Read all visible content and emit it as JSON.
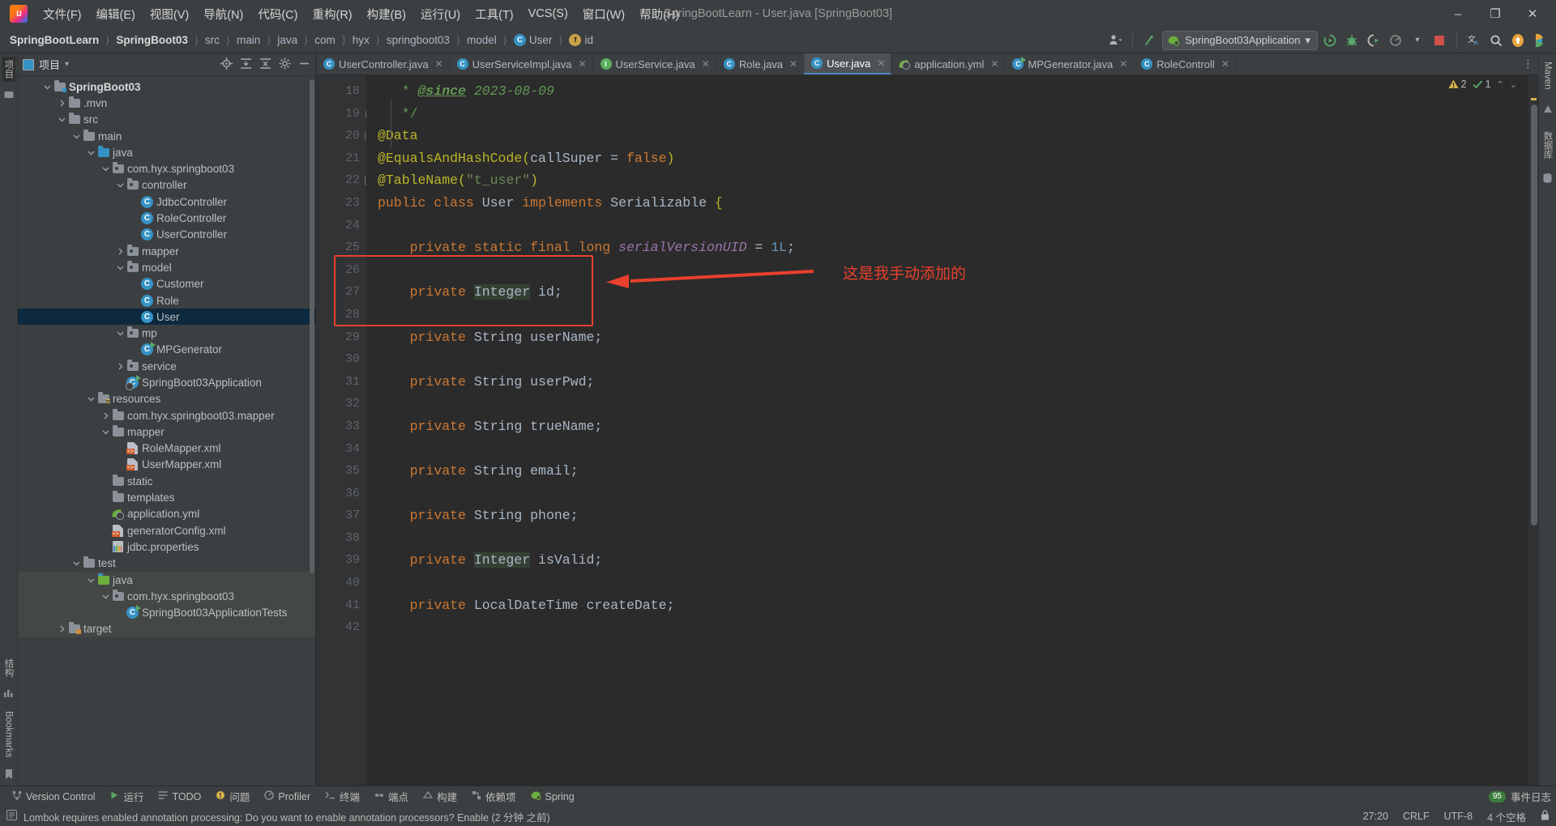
{
  "window": {
    "title": "SpringBootLearn - User.java [SpringBoot03]",
    "minimize": "–",
    "maximize": "❐",
    "close": "✕"
  },
  "menu": {
    "logo": "ij-logo",
    "items": [
      "文件(F)",
      "编辑(E)",
      "视图(V)",
      "导航(N)",
      "代码(C)",
      "重构(R)",
      "构建(B)",
      "运行(U)",
      "工具(T)",
      "VCS(S)",
      "窗口(W)",
      "帮助(H)"
    ]
  },
  "breadcrumb": {
    "items": [
      {
        "label": "SpringBootLearn",
        "icon": "",
        "bold": true
      },
      {
        "label": "SpringBoot03",
        "icon": "",
        "bold": true
      },
      {
        "label": "src",
        "icon": "",
        "bold": false
      },
      {
        "label": "main",
        "icon": "",
        "bold": false
      },
      {
        "label": "java",
        "icon": "",
        "bold": false
      },
      {
        "label": "com",
        "icon": "",
        "bold": false
      },
      {
        "label": "hyx",
        "icon": "",
        "bold": false
      },
      {
        "label": "springboot03",
        "icon": "",
        "bold": false
      },
      {
        "label": "model",
        "icon": "",
        "bold": false
      },
      {
        "label": "User",
        "icon": "class-badge",
        "bold": false
      },
      {
        "label": "id",
        "icon": "field-badge",
        "bold": false
      }
    ],
    "separator": "〉"
  },
  "toolbar": {
    "run_config": "SpringBoot03Application",
    "run_config_caret": "▾",
    "profile_icon": "user-profile-icon",
    "updates_icon": "updates-arrow-icon",
    "run_icon": "run-icon",
    "debug_icon": "debug-icon",
    "run_with_coverage_icon": "coverage-icon",
    "profiler_icon": "profiler-icon",
    "stop_icon": "stop-icon",
    "translate_icon": "translate-icon",
    "search_icon": "search-icon",
    "update_icon": "update-icon",
    "ide_icon": "ide-icon"
  },
  "project_panel": {
    "title": "项目",
    "caret": "▾",
    "header_icons": [
      "locate-icon",
      "expand-all-icon",
      "collapse-all-icon",
      "settings-icon",
      "hide-icon"
    ],
    "tree": [
      {
        "depth": 1,
        "arrow": "down",
        "icon": "folder-module",
        "label": "SpringBoot03",
        "bold": true,
        "sel": false,
        "shade": false
      },
      {
        "depth": 2,
        "arrow": "right",
        "icon": "folder",
        "label": ".mvn",
        "bold": false,
        "sel": false,
        "shade": false
      },
      {
        "depth": 2,
        "arrow": "down",
        "icon": "folder",
        "label": "src",
        "bold": false,
        "sel": false,
        "shade": false
      },
      {
        "depth": 3,
        "arrow": "down",
        "icon": "folder",
        "label": "main",
        "bold": false,
        "sel": false,
        "shade": false
      },
      {
        "depth": 4,
        "arrow": "down",
        "icon": "folder-source",
        "label": "java",
        "bold": false,
        "sel": false,
        "shade": false
      },
      {
        "depth": 5,
        "arrow": "down",
        "icon": "folder-package",
        "label": "com.hyx.springboot03",
        "bold": false,
        "sel": false,
        "shade": false
      },
      {
        "depth": 6,
        "arrow": "down",
        "icon": "folder-package",
        "label": "controller",
        "bold": false,
        "sel": false,
        "shade": false
      },
      {
        "depth": 7,
        "arrow": "none",
        "icon": "class",
        "label": "JdbcController",
        "bold": false,
        "sel": false,
        "shade": false
      },
      {
        "depth": 7,
        "arrow": "none",
        "icon": "class",
        "label": "RoleController",
        "bold": false,
        "sel": false,
        "shade": false
      },
      {
        "depth": 7,
        "arrow": "none",
        "icon": "class",
        "label": "UserController",
        "bold": false,
        "sel": false,
        "shade": false
      },
      {
        "depth": 6,
        "arrow": "right",
        "icon": "folder-package",
        "label": "mapper",
        "bold": false,
        "sel": false,
        "shade": false
      },
      {
        "depth": 6,
        "arrow": "down",
        "icon": "folder-package",
        "label": "model",
        "bold": false,
        "sel": false,
        "shade": false
      },
      {
        "depth": 7,
        "arrow": "none",
        "icon": "class",
        "label": "Customer",
        "bold": false,
        "sel": false,
        "shade": false
      },
      {
        "depth": 7,
        "arrow": "none",
        "icon": "class",
        "label": "Role",
        "bold": false,
        "sel": false,
        "shade": false
      },
      {
        "depth": 7,
        "arrow": "none",
        "icon": "class",
        "label": "User",
        "bold": false,
        "sel": true,
        "shade": false
      },
      {
        "depth": 6,
        "arrow": "down",
        "icon": "folder-package",
        "label": "mp",
        "bold": false,
        "sel": false,
        "shade": false
      },
      {
        "depth": 7,
        "arrow": "none",
        "icon": "class-runnable",
        "label": "MPGenerator",
        "bold": false,
        "sel": false,
        "shade": false
      },
      {
        "depth": 6,
        "arrow": "right",
        "icon": "folder-package",
        "label": "service",
        "bold": false,
        "sel": false,
        "shade": false
      },
      {
        "depth": 6,
        "arrow": "none",
        "icon": "class-spring",
        "label": "SpringBoot03Application",
        "bold": false,
        "sel": false,
        "shade": false
      },
      {
        "depth": 4,
        "arrow": "down",
        "icon": "folder-resource",
        "label": "resources",
        "bold": false,
        "sel": false,
        "shade": false
      },
      {
        "depth": 5,
        "arrow": "right",
        "icon": "folder",
        "label": "com.hyx.springboot03.mapper",
        "bold": false,
        "sel": false,
        "shade": false
      },
      {
        "depth": 5,
        "arrow": "down",
        "icon": "folder",
        "label": "mapper",
        "bold": false,
        "sel": false,
        "shade": false
      },
      {
        "depth": 6,
        "arrow": "none",
        "icon": "xml",
        "label": "RoleMapper.xml",
        "bold": false,
        "sel": false,
        "shade": false
      },
      {
        "depth": 6,
        "arrow": "none",
        "icon": "xml",
        "label": "UserMapper.xml",
        "bold": false,
        "sel": false,
        "shade": false
      },
      {
        "depth": 5,
        "arrow": "none",
        "icon": "folder",
        "label": "static",
        "bold": false,
        "sel": false,
        "shade": false
      },
      {
        "depth": 5,
        "arrow": "none",
        "icon": "folder",
        "label": "templates",
        "bold": false,
        "sel": false,
        "shade": false
      },
      {
        "depth": 5,
        "arrow": "none",
        "icon": "yml",
        "label": "application.yml",
        "bold": false,
        "sel": false,
        "shade": false
      },
      {
        "depth": 5,
        "arrow": "none",
        "icon": "xml",
        "label": "generatorConfig.xml",
        "bold": false,
        "sel": false,
        "shade": false
      },
      {
        "depth": 5,
        "arrow": "none",
        "icon": "properties",
        "label": "jdbc.properties",
        "bold": false,
        "sel": false,
        "shade": false
      },
      {
        "depth": 3,
        "arrow": "down",
        "icon": "folder",
        "label": "test",
        "bold": false,
        "sel": false,
        "shade": false
      },
      {
        "depth": 4,
        "arrow": "down",
        "icon": "folder-test",
        "label": "java",
        "bold": false,
        "sel": false,
        "shade": true
      },
      {
        "depth": 5,
        "arrow": "down",
        "icon": "folder-package",
        "label": "com.hyx.springboot03",
        "bold": false,
        "sel": false,
        "shade": true
      },
      {
        "depth": 6,
        "arrow": "none",
        "icon": "class-runnable",
        "label": "SpringBoot03ApplicationTests",
        "bold": false,
        "sel": false,
        "shade": true
      },
      {
        "depth": 2,
        "arrow": "right",
        "icon": "folder-target",
        "label": "target",
        "bold": false,
        "sel": false,
        "shade": true
      }
    ]
  },
  "left_strip": {
    "labels": [
      "项目"
    ],
    "bottom_labels": [
      "结构",
      "Bookmarks"
    ]
  },
  "right_strip": {
    "labels": [
      "Maven",
      "数据库"
    ]
  },
  "editor": {
    "tabs": [
      {
        "label": "UserController.java",
        "icon": "class",
        "active": false
      },
      {
        "label": "UserServiceImpl.java",
        "icon": "class",
        "active": false
      },
      {
        "label": "UserService.java",
        "icon": "interface",
        "active": false
      },
      {
        "label": "Role.java",
        "icon": "class",
        "active": false
      },
      {
        "label": "User.java",
        "icon": "class",
        "active": true
      },
      {
        "label": "application.yml",
        "icon": "yml",
        "active": false
      },
      {
        "label": "MPGenerator.java",
        "icon": "class-runnable",
        "active": false
      },
      {
        "label": "RoleControll",
        "icon": "class",
        "active": false
      }
    ],
    "tab_close": "✕",
    "tabbar_overflow": "⋮",
    "inspection": {
      "warnings": "2",
      "weak_warnings": "1",
      "warn_icon": "warning-triangle-icon",
      "ok_icon": "check-icon",
      "up_icon": "⌃",
      "down_icon": "⌄"
    },
    "lines": [
      {
        "no": "18",
        "fold": "",
        "html": "   <span class='cmt'>* </span><span class='doclink'>@since</span><span class='cmt'> <i>2023-08-09</i></span>"
      },
      {
        "no": "19",
        "fold": "end",
        "html": "   <span class='cmt'>*/</span>"
      },
      {
        "no": "20",
        "fold": "start",
        "html": "<span class='ann'>@Data</span>"
      },
      {
        "no": "21",
        "fold": "",
        "html": "<span class='ann'>@EqualsAndHashCode</span><span class='ann'>(</span><span class='id'>callSuper</span> <span class='punct'>=</span> <span class='kw'>false</span><span class='ann'>)</span>"
      },
      {
        "no": "22",
        "fold": "start",
        "html": "<span class='ann'>@TableName</span><span class='ann'>(</span><span class='str'>\"t_user\"</span><span class='ann'>)</span>"
      },
      {
        "no": "23",
        "fold": "",
        "html": "<span class='kw'>public class </span><span class='id'>User </span><span class='kw'>implements </span><span class='id'>Serializable </span><span class='ann'>{</span>"
      },
      {
        "no": "24",
        "fold": "",
        "html": ""
      },
      {
        "no": "25",
        "fold": "",
        "html": "    <span class='kw'>private static final long </span><span class='fld'>serialVersionUID</span> <span class='punct'>=</span> <span class='num'>1L</span><span class='punct'>;</span>"
      },
      {
        "no": "26",
        "fold": "",
        "html": ""
      },
      {
        "no": "27",
        "fold": "",
        "html": "    <span class='kw'>private </span><span class='hl-bg id'>Integer</span> <span class='id'>id</span><span class='punct'>;</span>"
      },
      {
        "no": "28",
        "fold": "",
        "html": ""
      },
      {
        "no": "29",
        "fold": "",
        "html": "    <span class='kw'>private </span><span class='id'>String</span> <span class='id'>userName</span><span class='punct'>;</span>"
      },
      {
        "no": "30",
        "fold": "",
        "html": ""
      },
      {
        "no": "31",
        "fold": "",
        "html": "    <span class='kw'>private </span><span class='id'>String</span> <span class='id'>userPwd</span><span class='punct'>;</span>"
      },
      {
        "no": "32",
        "fold": "",
        "html": ""
      },
      {
        "no": "33",
        "fold": "",
        "html": "    <span class='kw'>private </span><span class='id'>String</span> <span class='id'>trueName</span><span class='punct'>;</span>"
      },
      {
        "no": "34",
        "fold": "",
        "html": ""
      },
      {
        "no": "35",
        "fold": "",
        "html": "    <span class='kw'>private </span><span class='id'>String</span> <span class='id'>email</span><span class='punct'>;</span>"
      },
      {
        "no": "36",
        "fold": "",
        "html": ""
      },
      {
        "no": "37",
        "fold": "",
        "html": "    <span class='kw'>private </span><span class='id'>String</span> <span class='id'>phone</span><span class='punct'>;</span>"
      },
      {
        "no": "38",
        "fold": "",
        "html": ""
      },
      {
        "no": "39",
        "fold": "",
        "html": "    <span class='kw'>private </span><span class='hl-bg id'>Integer</span> <span class='id'>isValid</span><span class='punct'>;</span>"
      },
      {
        "no": "40",
        "fold": "",
        "html": ""
      },
      {
        "no": "41",
        "fold": "",
        "html": "    <span class='kw'>private </span><span class='id'>LocalDateTime</span> <span class='id'>createDate</span><span class='punct'>;</span>"
      },
      {
        "no": "42",
        "fold": "",
        "html": ""
      }
    ],
    "annotation": {
      "note": "这是我手动添加的",
      "color": "#e8402c"
    }
  },
  "bottom_toolwindows": [
    {
      "label": "Version Control",
      "icon": "branch-icon"
    },
    {
      "label": "运行",
      "icon": "run-icon"
    },
    {
      "label": "TODO",
      "icon": "todo-icon"
    },
    {
      "label": "问题",
      "icon": "problems-icon"
    },
    {
      "label": "Profiler",
      "icon": "profiler-icon"
    },
    {
      "label": "终端",
      "icon": "terminal-icon"
    },
    {
      "label": "端点",
      "icon": "endpoints-icon"
    },
    {
      "label": "构建",
      "icon": "build-icon"
    },
    {
      "label": "依赖项",
      "icon": "dependencies-icon"
    },
    {
      "label": "Spring",
      "icon": "spring-icon"
    }
  ],
  "bottom_right": {
    "event_log": "事件日志",
    "event_count": "95"
  },
  "notification": {
    "icon": "info-icon",
    "text": "Lombok requires enabled annotation processing: Do you want to enable annotation processors? Enable (2 分钟 之前)"
  },
  "status_bar": {
    "caret": "27:20",
    "line_sep": "CRLF",
    "encoding": "UTF-8",
    "indent": "4 个空格",
    "lock_icon": "lock-icon"
  }
}
